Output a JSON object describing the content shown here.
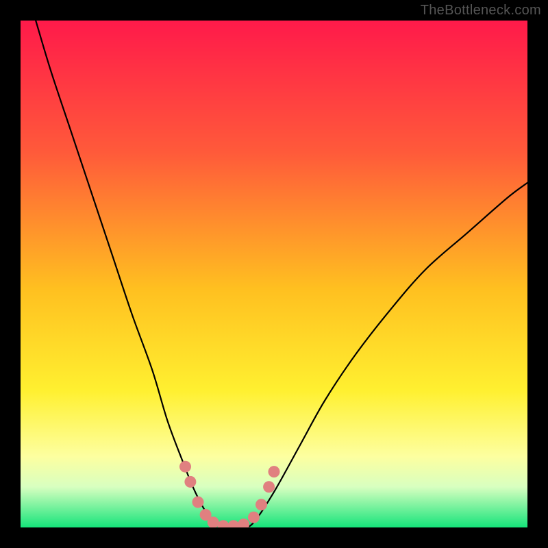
{
  "watermark": "TheBottleneck.com",
  "chart_data": {
    "type": "line",
    "title": "",
    "xlabel": "",
    "ylabel": "",
    "xlim": [
      0,
      100
    ],
    "ylim": [
      0,
      100
    ],
    "background_gradient": {
      "stops": [
        {
          "offset": 0,
          "color": "#ff1a4a"
        },
        {
          "offset": 26,
          "color": "#ff5a3a"
        },
        {
          "offset": 53,
          "color": "#ffc020"
        },
        {
          "offset": 73,
          "color": "#fff030"
        },
        {
          "offset": 86,
          "color": "#fdffa0"
        },
        {
          "offset": 92,
          "color": "#d8ffc0"
        },
        {
          "offset": 100,
          "color": "#15e47a"
        }
      ]
    },
    "series": [
      {
        "name": "left-curve",
        "x": [
          3,
          6,
          10,
          14,
          18,
          22,
          26,
          29,
          32,
          34,
          36,
          38
        ],
        "y": [
          100,
          90,
          78,
          66,
          54,
          42,
          31,
          21,
          13,
          8,
          4,
          1
        ]
      },
      {
        "name": "valley-floor",
        "x": [
          38,
          40,
          42,
          44,
          46
        ],
        "y": [
          1,
          0,
          0,
          0,
          1
        ]
      },
      {
        "name": "right-curve",
        "x": [
          46,
          50,
          55,
          60,
          66,
          73,
          80,
          88,
          96,
          100
        ],
        "y": [
          1,
          7,
          16,
          25,
          34,
          43,
          51,
          58,
          65,
          68
        ]
      }
    ],
    "markers": {
      "name": "salmon-dots",
      "color": "#e08080",
      "points": [
        {
          "x": 32.5,
          "y": 12
        },
        {
          "x": 33.5,
          "y": 9
        },
        {
          "x": 35.0,
          "y": 5
        },
        {
          "x": 36.5,
          "y": 2.5
        },
        {
          "x": 38.0,
          "y": 1
        },
        {
          "x": 40.0,
          "y": 0.3
        },
        {
          "x": 42.0,
          "y": 0.3
        },
        {
          "x": 44.0,
          "y": 0.6
        },
        {
          "x": 46.0,
          "y": 2
        },
        {
          "x": 47.5,
          "y": 4.5
        },
        {
          "x": 49.0,
          "y": 8
        },
        {
          "x": 50.0,
          "y": 11
        }
      ]
    }
  }
}
